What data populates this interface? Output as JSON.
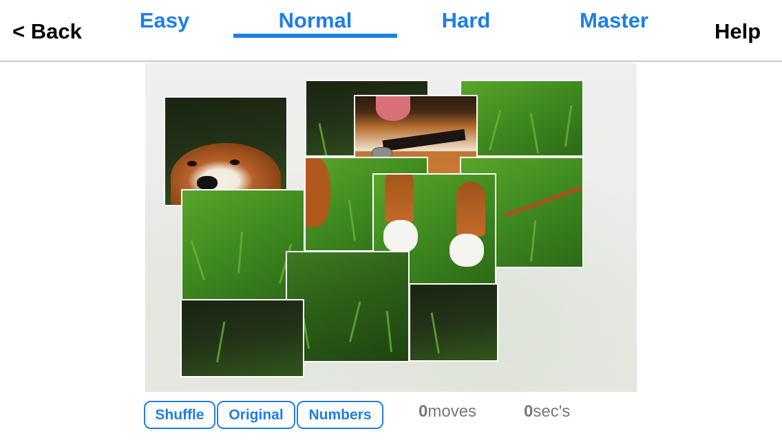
{
  "header": {
    "back_label": "< Back",
    "help_label": "Help",
    "tabs": [
      {
        "label": "Easy",
        "selected": false
      },
      {
        "label": "Normal",
        "selected": true
      },
      {
        "label": "Hard",
        "selected": false
      },
      {
        "label": "Master",
        "selected": false
      }
    ]
  },
  "puzzle": {
    "difficulty": "Normal",
    "image_subject": "dog in grass",
    "tiles_visible": 12
  },
  "controls": {
    "shuffle_label": "Shuffle",
    "original_label": "Original",
    "numbers_label": "Numbers"
  },
  "stats": {
    "moves_count": "0",
    "moves_label": "moves",
    "secs_count": "0",
    "secs_label": "sec's"
  },
  "colors": {
    "accent": "#1e7ee6",
    "divider": "#c8c8c8",
    "stat_text": "#777777"
  }
}
